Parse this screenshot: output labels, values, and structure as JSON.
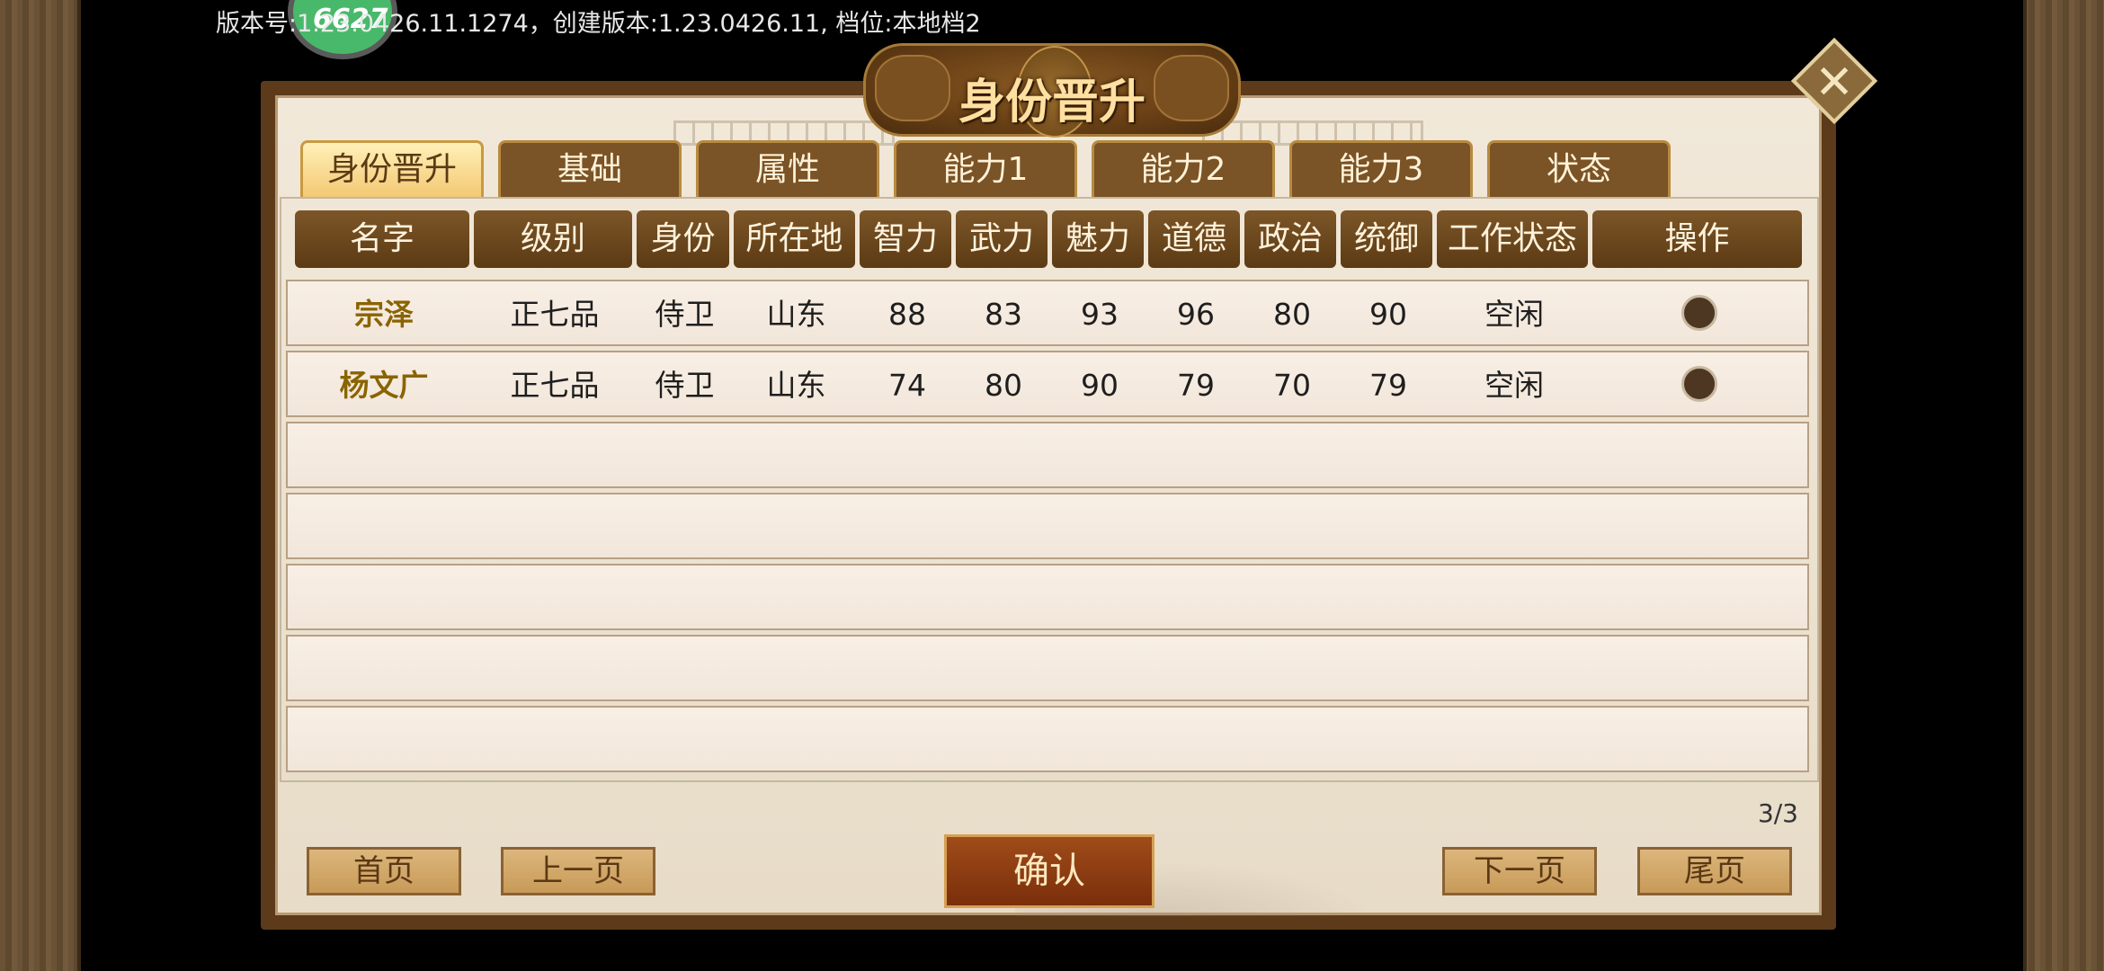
{
  "version_text": "版本号:1.23.0426.11.1274，创建版本:1.23.0426.11, 档位:本地档2",
  "badge_text": "6627",
  "title": "身份晋升",
  "close_symbol": "✕",
  "tabs": [
    {
      "label": "身份晋升",
      "active": true
    },
    {
      "label": "基础",
      "active": false
    },
    {
      "label": "属性",
      "active": false
    },
    {
      "label": "能力1",
      "active": false
    },
    {
      "label": "能力2",
      "active": false
    },
    {
      "label": "能力3",
      "active": false
    },
    {
      "label": "状态",
      "active": false
    }
  ],
  "table": {
    "headers": [
      "名字",
      "级别",
      "身份",
      "所在地",
      "智力",
      "武力",
      "魅力",
      "道德",
      "政治",
      "统御",
      "工作状态",
      "操作"
    ],
    "rows": [
      {
        "name": "宗泽",
        "rank": "正七品",
        "identity": "侍卫",
        "location": "山东",
        "intelligence": "88",
        "force": "83",
        "charm": "93",
        "morality": "96",
        "politics": "80",
        "command": "90",
        "work_status": "空闲"
      },
      {
        "name": "杨文广",
        "rank": "正七品",
        "identity": "侍卫",
        "location": "山东",
        "intelligence": "74",
        "force": "80",
        "charm": "90",
        "morality": "79",
        "politics": "70",
        "command": "79",
        "work_status": "空闲"
      }
    ],
    "empty_rows": 5
  },
  "pagination": {
    "counter": "3/3",
    "first": "首页",
    "prev": "上一页",
    "next": "下一页",
    "last": "尾页"
  },
  "confirm_label": "确认",
  "colors": {
    "panel_frame": "#5c3a1a",
    "header_bg": "#6a4418",
    "name_text": "#8a6400",
    "active_tab": "#f3c872",
    "confirm_bg": "#8a3a12"
  }
}
